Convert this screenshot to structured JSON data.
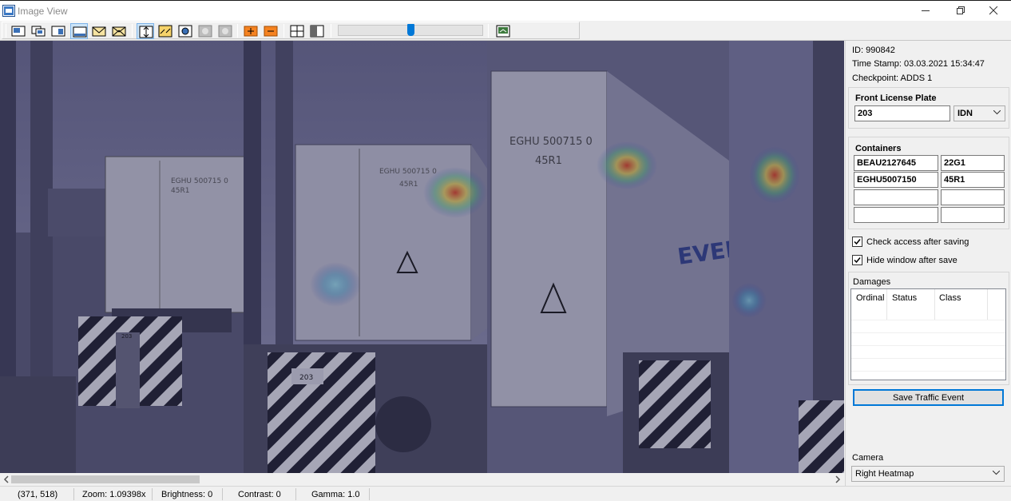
{
  "window": {
    "title": "Image View",
    "controls": [
      "minimize-icon",
      "restore-icon",
      "close-icon"
    ]
  },
  "toolbar": {
    "icons": [
      "layout-1-icon",
      "layout-2-icon",
      "layout-3-icon",
      "layout-bottom-icon",
      "envelope-icon",
      "envelope-open-icon",
      "fit-vertical-icon",
      "fit-arrows-icon",
      "center-view-icon",
      "overlay-a-icon",
      "overlay-b-icon",
      "zoom-in-icon",
      "zoom-out-icon",
      "split-view-icon",
      "half-view-icon",
      "export-image-icon"
    ],
    "slider_level": 0.5
  },
  "colors": {
    "accent": "#0078d7",
    "heat_hot": "#e33c1e",
    "heat_warm": "#f4d84c",
    "tint": "#2b2b4a"
  },
  "viewer": {
    "plate_texts": [
      "203",
      "203"
    ],
    "container_texts": [
      "EGHU 500715 0",
      "45R1",
      "EGHU 500715 0",
      "45R1"
    ],
    "brand_text": "EVERGREEN"
  },
  "status": {
    "coords": "(371, 518)",
    "zoom": "Zoom: 1.09398x",
    "brightness": "Brightness: 0",
    "contrast": "Contrast: 0",
    "gamma": "Gamma: 1.0"
  },
  "info": {
    "id": "ID: 990842",
    "timestamp": "Time Stamp: 03.03.2021 15:34:47",
    "checkpoint": "Checkpoint: ADDS 1"
  },
  "plate": {
    "title": "Front License Plate",
    "value": "203",
    "country": "IDN"
  },
  "containers": {
    "title": "Containers",
    "rows": [
      {
        "number": "BEAU2127645",
        "type": "22G1"
      },
      {
        "number": "EGHU5007150",
        "type": "45R1"
      },
      {
        "number": "",
        "type": ""
      },
      {
        "number": "",
        "type": ""
      }
    ]
  },
  "options": {
    "check_access": "Check access after saving",
    "hide_window": "Hide window after save"
  },
  "damages": {
    "title": "Damages",
    "columns": [
      "Ordinal",
      "Status",
      "Class"
    ]
  },
  "save_button": "Save Traffic Event",
  "camera": {
    "label": "Camera",
    "value": "Right Heatmap"
  }
}
